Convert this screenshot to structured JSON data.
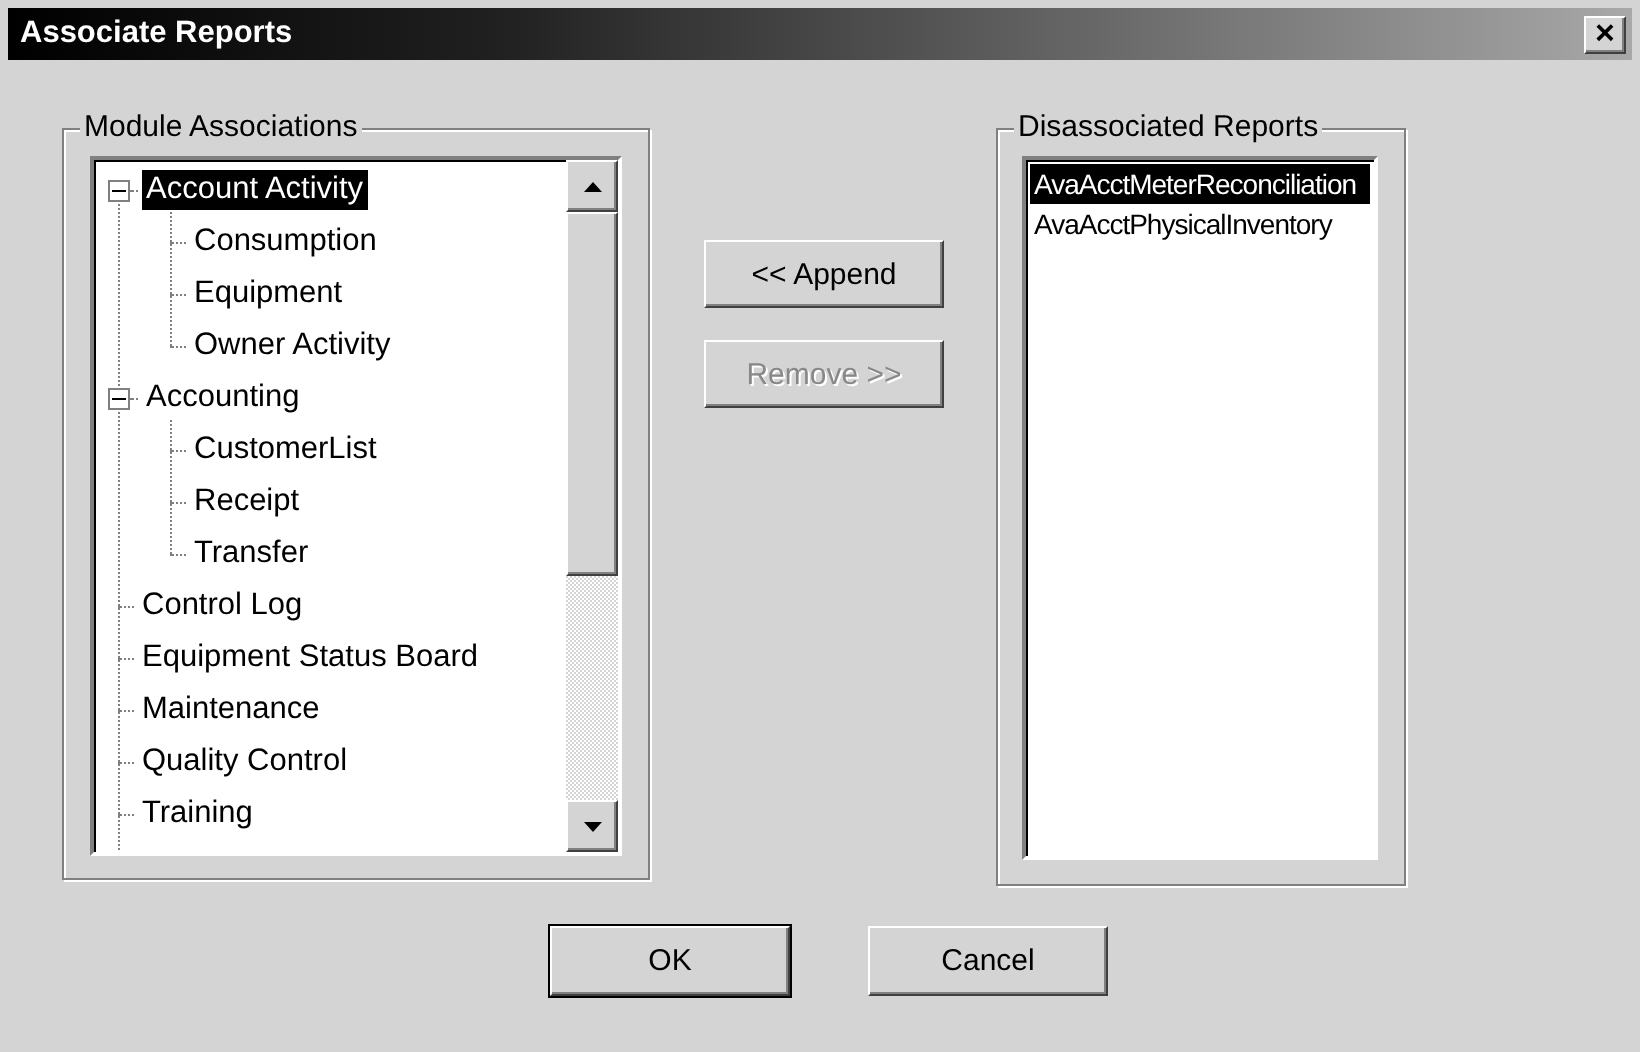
{
  "window": {
    "title": "Associate Reports",
    "close": "×"
  },
  "modules": {
    "title": "Module Associations",
    "tree": [
      {
        "label": "Account Activity",
        "selected": true,
        "expanded": true,
        "children": [
          {
            "label": "Consumption",
            "selected": false
          },
          {
            "label": "Equipment",
            "selected": false
          },
          {
            "label": "Owner Activity",
            "selected": false
          }
        ]
      },
      {
        "label": "Accounting",
        "selected": false,
        "expanded": true,
        "children": [
          {
            "label": "CustomerList",
            "selected": false
          },
          {
            "label": "Receipt",
            "selected": false
          },
          {
            "label": "Transfer",
            "selected": false
          }
        ]
      },
      {
        "label": "Control Log",
        "selected": false
      },
      {
        "label": "Equipment Status Board",
        "selected": false
      },
      {
        "label": "Maintenance",
        "selected": false
      },
      {
        "label": "Quality Control",
        "selected": false
      },
      {
        "label": "Training",
        "selected": false
      }
    ]
  },
  "actions": [
    {
      "label": "<< Append",
      "disabled": false
    },
    {
      "label": "Remove >>",
      "disabled": true
    }
  ],
  "disassociated": {
    "title": "Disassociated Reports",
    "items": [
      {
        "label": "AvaAcctMeterReconciliation",
        "selected": true
      },
      {
        "label": "AvaAcctPhysicalInventory",
        "selected": false
      }
    ]
  },
  "buttons": [
    {
      "label": "OK",
      "default": true
    },
    {
      "label": "Cancel",
      "default": false
    }
  ]
}
